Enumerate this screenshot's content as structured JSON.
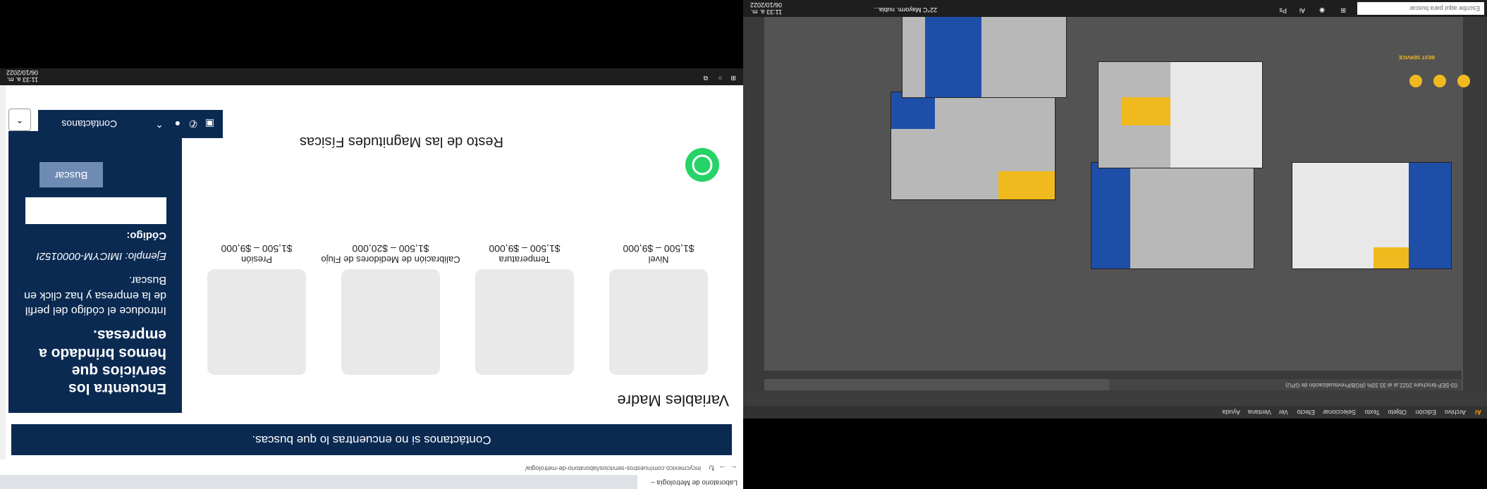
{
  "browser": {
    "tab_title": "Laboratorio de Metrología – Incy...",
    "url": "incycmexico.com/nuestros-servicios/laboratorio-de-metrologia/",
    "top_banner": "Contáctanos si no encuentras lo que buscas.",
    "section_title": "Variables Madre",
    "products": [
      {
        "label": "Nivel",
        "price": "$1,500 – $9,000"
      },
      {
        "label": "Temperatura",
        "price": "$1,500 – $9,000"
      },
      {
        "label": "Calibración de Medidores de Flujo",
        "price": "$1,500 – $20,000"
      },
      {
        "label": "Presión",
        "price": "$1,500 – $9,000"
      }
    ],
    "search_panel": {
      "heading": "Encuentra los servicios que hemos brindado a empresas.",
      "instructions": "Introduce el código del perfil de la empresa y haz click en Buscar.",
      "example": "Ejemplo: IMICYM-0000152I",
      "code_label": "Código:",
      "button": "Buscar"
    },
    "next_title": "Resto de las Magnitudes Físicas",
    "contact_label": "Contáctanos",
    "taskbar_time": "11:33 a. m.",
    "taskbar_date": "06/10/2022"
  },
  "illustrator": {
    "menu": [
      "Archivo",
      "Edición",
      "Objeto",
      "Texto",
      "Seleccionar",
      "Efecto",
      "Ver",
      "Ventana",
      "Ayuda"
    ],
    "doc_tab": "03-SEP-brochure 2022.ai al 33.33% (RGB/Previsualización de GPU)",
    "logo_text": "BEST SERVICE",
    "taskbar_search_placeholder": "Escribe aquí para buscar",
    "weather": "22°C Mayorm. nubla...",
    "taskbar_time": "11:33 a. m.",
    "taskbar_date": "06/10/2022"
  }
}
